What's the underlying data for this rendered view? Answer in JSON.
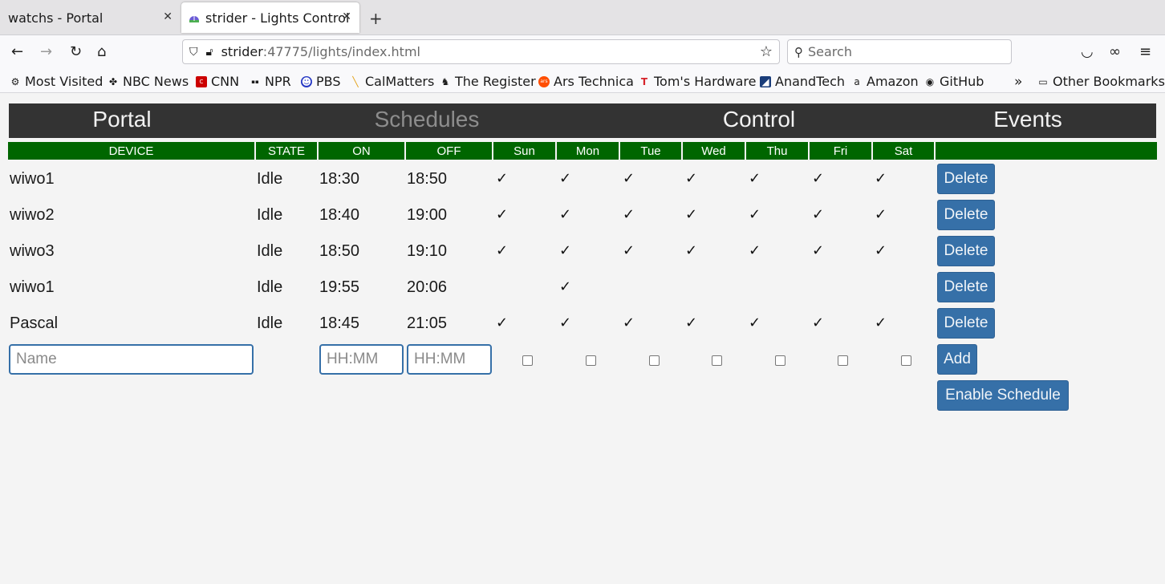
{
  "browser": {
    "tabs": [
      {
        "title": "watchs - Portal",
        "active": false
      },
      {
        "title": "strider - Lights Control",
        "active": true
      }
    ],
    "url_host": "strider",
    "url_path": ":47775/lights/index.html",
    "search_placeholder": "Search",
    "bookmarks": [
      {
        "label": "Most Visited",
        "icon": "gear-icon"
      },
      {
        "label": "NBC News",
        "icon": "nbc-icon"
      },
      {
        "label": "CNN",
        "icon": "cnn-icon"
      },
      {
        "label": "NPR",
        "icon": "npr-icon"
      },
      {
        "label": "PBS",
        "icon": "pbs-icon"
      },
      {
        "label": "CalMatters",
        "icon": "calmatters-icon"
      },
      {
        "label": "The Register",
        "icon": "register-icon"
      },
      {
        "label": "Ars Technica",
        "icon": "ars-icon"
      },
      {
        "label": "Tom's Hardware",
        "icon": "toms-icon"
      },
      {
        "label": "AnandTech",
        "icon": "anandtech-icon"
      },
      {
        "label": "Amazon",
        "icon": "amazon-icon"
      },
      {
        "label": "GitHub",
        "icon": "github-icon"
      }
    ],
    "other_bookmarks": "Other Bookmarks"
  },
  "nav": {
    "items": [
      "Portal",
      "Schedules",
      "Control",
      "Events"
    ],
    "active": "Schedules"
  },
  "table": {
    "headers": [
      "DEVICE",
      "STATE",
      "ON",
      "OFF",
      "Sun",
      "Mon",
      "Tue",
      "Wed",
      "Thu",
      "Fri",
      "Sat"
    ],
    "check_glyph": "✓",
    "rows": [
      {
        "device": "wiwo1",
        "state": "Idle",
        "on": "18:30",
        "off": "18:50",
        "days": [
          1,
          1,
          1,
          1,
          1,
          1,
          1
        ],
        "action": "Delete"
      },
      {
        "device": "wiwo2",
        "state": "Idle",
        "on": "18:40",
        "off": "19:00",
        "days": [
          1,
          1,
          1,
          1,
          1,
          1,
          1
        ],
        "action": "Delete"
      },
      {
        "device": "wiwo3",
        "state": "Idle",
        "on": "18:50",
        "off": "19:10",
        "days": [
          1,
          1,
          1,
          1,
          1,
          1,
          1
        ],
        "action": "Delete"
      },
      {
        "device": "wiwo1",
        "state": "Idle",
        "on": "19:55",
        "off": "20:06",
        "days": [
          0,
          1,
          0,
          0,
          0,
          0,
          0
        ],
        "action": "Delete"
      },
      {
        "device": "Pascal",
        "state": "Idle",
        "on": "18:45",
        "off": "21:05",
        "days": [
          1,
          1,
          1,
          1,
          1,
          1,
          1
        ],
        "action": "Delete"
      }
    ],
    "new_row": {
      "name_placeholder": "Name",
      "on_placeholder": "HH:MM",
      "off_placeholder": "HH:MM",
      "add_label": "Add"
    },
    "enable_label": "Enable Schedule"
  },
  "colors": {
    "header_green": "#006600",
    "nav_dark": "#333333",
    "button_blue": "#3670a8"
  }
}
